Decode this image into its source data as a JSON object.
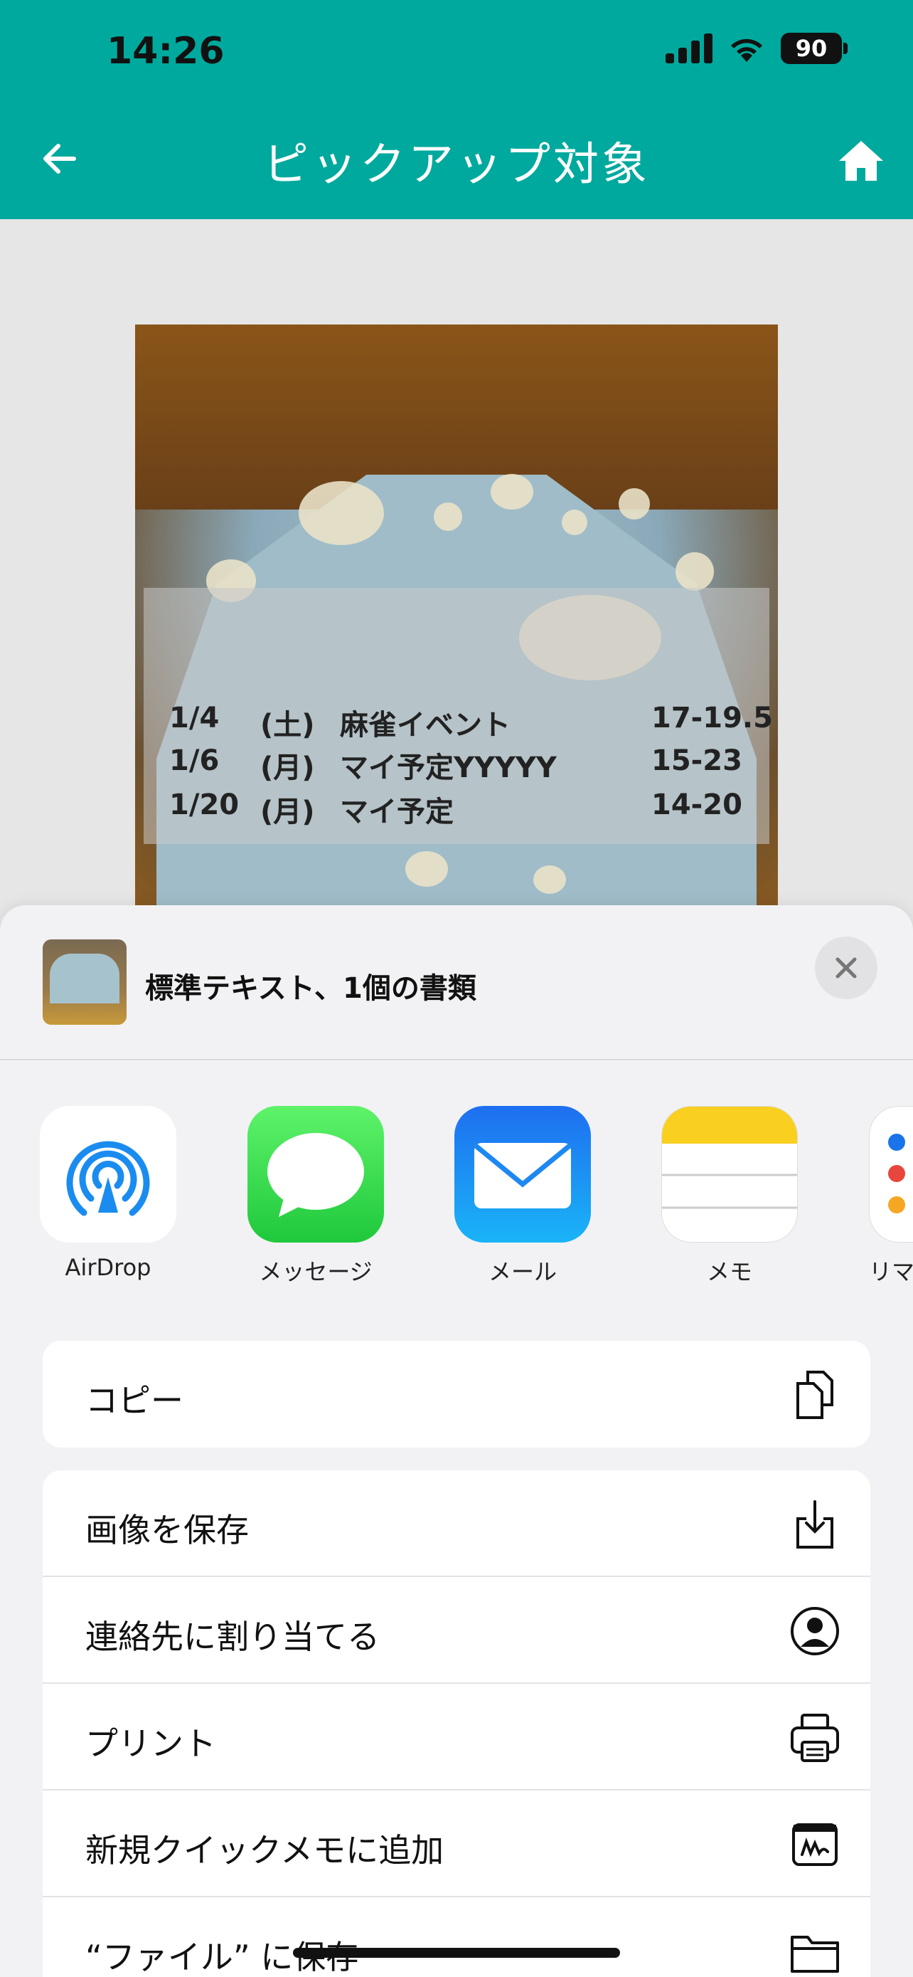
{
  "status": {
    "time": "14:26",
    "battery": "90"
  },
  "nav": {
    "title": "ピックアップ対象"
  },
  "schedule": [
    {
      "date": "1/4",
      "day": "(土)",
      "event": "麻雀イベント",
      "time": "17-19.5"
    },
    {
      "date": "1/6",
      "day": "(月)",
      "event": "マイ予定YYYYY",
      "time": "15-23"
    },
    {
      "date": "1/20",
      "day": "(月)",
      "event": "マイ予定",
      "time": "14-20"
    }
  ],
  "share": {
    "title": "標準テキスト、1個の書類",
    "apps": [
      {
        "label": "AirDrop",
        "icon": "airdrop-icon"
      },
      {
        "label": "メッセージ",
        "icon": "messages-icon"
      },
      {
        "label": "メール",
        "icon": "mail-icon"
      },
      {
        "label": "メモ",
        "icon": "notes-icon"
      },
      {
        "label": "リマ",
        "icon": "reminders-icon"
      }
    ],
    "actions": {
      "copy": "コピー",
      "save_image": "画像を保存",
      "assign_contact": "連絡先に割り当てる",
      "print": "プリント",
      "quick_note": "新規クイックメモに追加",
      "save_files": "“ファイル” に保存"
    }
  },
  "colors": {
    "accent": "#00a99d",
    "sheet": "#f2f2f4"
  }
}
